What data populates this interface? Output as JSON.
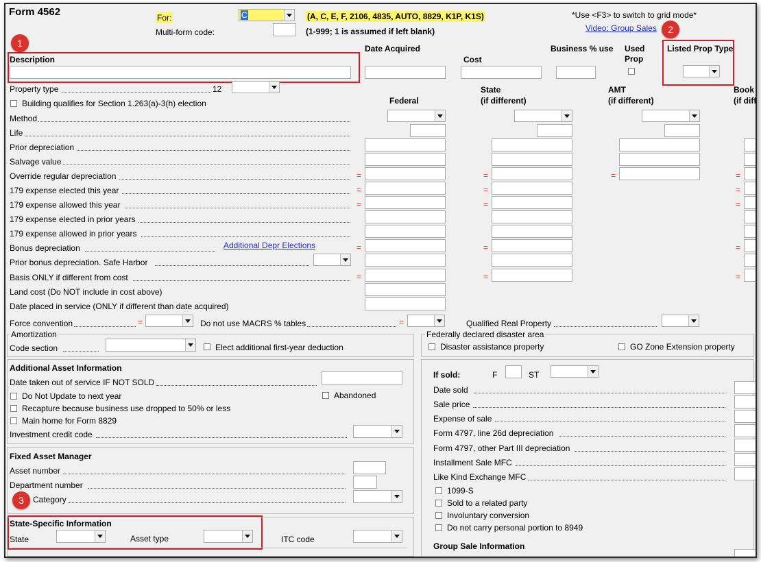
{
  "header": {
    "form_title": "Form 4562",
    "for_label": "For:",
    "for_value": "C",
    "for_options": "(A, C, E, F, 2106, 4835, AUTO, 8829, K1P, K1S)",
    "multiform_label": "Multi-form code:",
    "multiform_hint": "(1-999; 1 is assumed if left blank)",
    "grid_note": "*Use <F3> to switch to grid mode*",
    "video_link": "Video: Group Sales"
  },
  "badges": {
    "b1": "1",
    "b2": "2",
    "b3": "3"
  },
  "top_fields": {
    "description": "Description",
    "date_acquired": "Date Acquired",
    "cost": "Cost",
    "business_pct": "Business % use",
    "used": "Used",
    "prop": "Prop",
    "listed_prop_type": "Listed Prop Type"
  },
  "property": {
    "type_label": "Property type",
    "type_value": "12",
    "section_1263": "Building qualifies for Section 1.263(a)-3(h) election"
  },
  "columns": {
    "federal": "Federal",
    "state": "State",
    "state_sub": "(if different)",
    "amt": "AMT",
    "amt_sub": "(if different)",
    "book": "Book",
    "book_sub": "(if diff"
  },
  "rows": {
    "method": "Method",
    "life": "Life",
    "prior_depr": "Prior depreciation",
    "salvage": "Salvage value",
    "override": "Override regular depreciation",
    "elected_179": "179 expense elected this year",
    "allowed_179": "179 expense allowed this year",
    "elected_prior_179": "179 expense elected in prior years",
    "allowed_prior_179": "179 expense allowed in prior years",
    "bonus": "Bonus depreciation",
    "bonus_link": "Additional Depr Elections",
    "prior_bonus": "Prior bonus depreciation.  Safe Harbor",
    "basis_only": "Basis ONLY if different from cost",
    "land_cost": "Land cost (Do NOT include in cost above)",
    "date_placed": "Date placed in service (ONLY if different than date acquired)",
    "force_conv": "Force convention",
    "no_macrs": "Do not use MACRS % tables",
    "qualified_real": "Qualified Real Property"
  },
  "eq_sign": "=",
  "amortization": {
    "title": "Amortization",
    "code_section": "Code section",
    "elect_additional": "Elect additional first-year deduction"
  },
  "disaster": {
    "title": "Federally declared disaster area",
    "assistance": "Disaster assistance property",
    "go_zone": "GO Zone Extension property"
  },
  "additional": {
    "title": "Additional Asset Information",
    "date_out": "Date taken out of service IF NOT SOLD",
    "no_update": "Do Not Update to next year",
    "abandoned": "Abandoned",
    "recapture": "Recapture because business use dropped to 50% or less",
    "main_home": "Main home for Form 8829",
    "investment_credit": "Investment credit code"
  },
  "fixed_asset": {
    "title": "Fixed Asset Manager",
    "asset_number": "Asset number",
    "department": "Department number",
    "category": "Category"
  },
  "state_specific": {
    "title": "State-Specific Information",
    "state": "State",
    "asset_type": "Asset type",
    "itc_code": "ITC code"
  },
  "sold": {
    "if_sold": "If sold:",
    "f": "F",
    "st": "ST",
    "date_sold": "Date sold",
    "sale_price": "Sale price",
    "expense": "Expense of sale",
    "f4797_26d": "Form 4797, line 26d depreciation",
    "f4797_part3": "Form 4797, other Part III depreciation",
    "installment": "Installment Sale MFC",
    "like_kind": "Like Kind Exchange MFC",
    "c1099s": "1099-S",
    "related": "Sold to a related party",
    "involuntary": "Involuntary conversion",
    "no_carry": "Do not carry personal portion to 8949",
    "group_sale": "Group Sale Information"
  }
}
